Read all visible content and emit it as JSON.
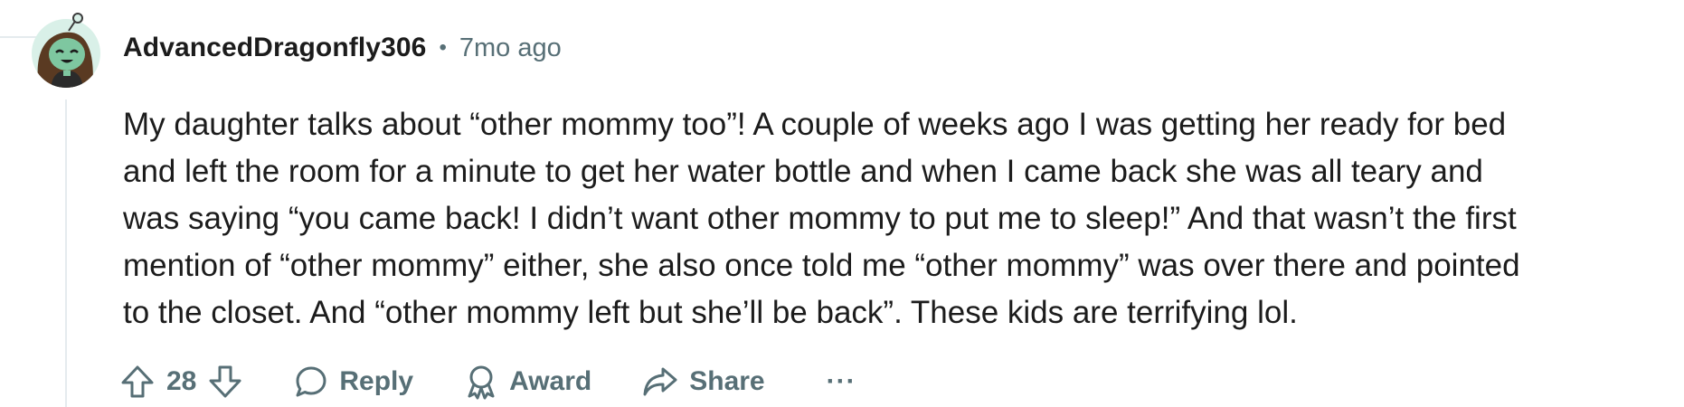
{
  "comment": {
    "author": "AdvancedDragonfly306",
    "separator": "•",
    "timestamp": "7mo ago",
    "body_lines": [
      "My daughter talks about “other mommy too”! A couple of weeks ago I was getting her ready for bed",
      "and left the room for a minute to get her water bottle and when I came back she was all teary and",
      "was saying “you came back! I didn’t want other mommy to put me to sleep!” And that wasn’t the first",
      "mention of “other mommy” either, she also once told me “other mommy” was over there and pointed",
      "to the closet. And “other mommy left but she’ll be back”. These kids are terrifying lol."
    ],
    "votes": "28",
    "actions": {
      "reply_label": "Reply",
      "award_label": "Award",
      "share_label": "Share",
      "more_label": "···"
    },
    "icons": {
      "upvote": "upvote-arrow-icon",
      "downvote": "downvote-arrow-icon",
      "reply": "speech-bubble-icon",
      "award": "award-ribbon-icon",
      "share": "share-arrow-icon",
      "avatar": "snoo-avatar-icon"
    },
    "colors": {
      "text": "#1c1c1c",
      "meta": "#576f76",
      "thread_line": "#e5ebee",
      "avatar_bg": "#d9f0e8"
    }
  }
}
